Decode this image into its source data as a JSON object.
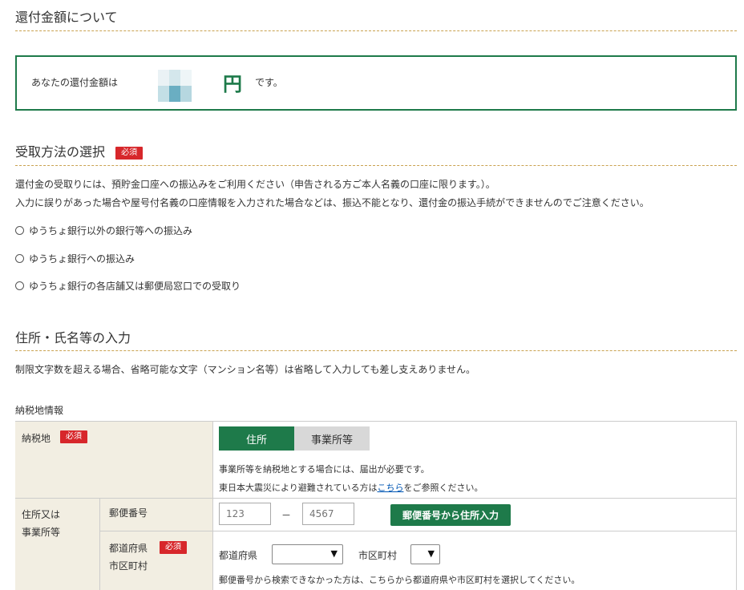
{
  "refund_section": {
    "heading": "還付金額について",
    "prefix": "あなたの還付金額は",
    "currency": "円",
    "suffix": "です。"
  },
  "receipt_section": {
    "heading": "受取方法の選択",
    "required_label": "必須",
    "desc_line1": "還付金の受取りには、預貯金口座への振込みをご利用ください（申告される方ご本人名義の口座に限ります。）。",
    "desc_line2": "入力に誤りがあった場合や屋号付名義の口座情報を入力された場合などは、振込不能となり、還付金の振込手続ができませんのでご注意ください。",
    "options": [
      "ゆうちょ銀行以外の銀行等への振込み",
      "ゆうちょ銀行への振込み",
      "ゆうちょ銀行の各店舗又は郵便局窓口での受取り"
    ]
  },
  "address_section": {
    "heading": "住所・氏名等の入力",
    "desc": "制限文字数を超える場合、省略可能な文字（マンション名等）は省略して入力しても差し支えありません。",
    "table_title": "納税地情報",
    "nozeichi_label": "納税地",
    "required_label": "必須",
    "tabs": [
      "住所",
      "事業所等"
    ],
    "note1": "事業所等を納税地とする場合には、届出が必要です。",
    "note2_before": "東日本大震災により避難されている方は",
    "note2_link": "こちら",
    "note2_after": "をご参照ください。",
    "addr_label_line1": "住所又は",
    "addr_label_line2": "事業所等",
    "postal_label": "郵便番号",
    "postal_placeholder1": "123",
    "postal_dash": "－",
    "postal_placeholder2": "4567",
    "postal_button": "郵便番号から住所入力",
    "pref_label_line1": "都道府県",
    "pref_label_line2": "市区町村",
    "pref_select_label": "都道府県",
    "city_select_label": "市区町村",
    "pref_note": "郵便番号から検索できなかった方は、こちらから都道府県や市区町村を選択してください。"
  },
  "colors": {
    "accent_green": "#1e7a4a",
    "required_red": "#d7272b",
    "rule_gold": "#c9a250",
    "label_bg": "#f2eee2"
  }
}
